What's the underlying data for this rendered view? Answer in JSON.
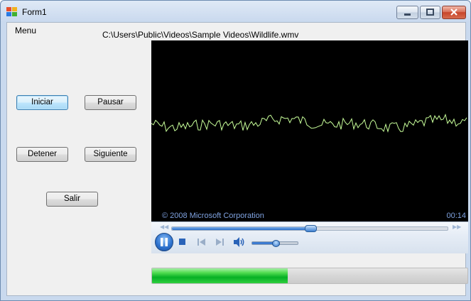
{
  "window": {
    "title": "Form1",
    "app_icon": "windows-forms-icon"
  },
  "caption_buttons": {
    "minimize_icon": "minimize-icon",
    "maximize_icon": "maximize-icon",
    "close_icon": "close-icon"
  },
  "menu": {
    "label": "Menu"
  },
  "file_path": "C:\\Users\\Public\\Videos\\Sample Videos\\Wildlife.wmv",
  "buttons": {
    "start": "Iniciar",
    "pause": "Pausar",
    "stop": "Detener",
    "next": "Siguiente",
    "exit": "Salir"
  },
  "player": {
    "copyright": "© 2008 Microsoft Corporation",
    "time": "00:14",
    "seek_fraction": 0.5,
    "volume_fraction": 0.5,
    "visualization_color": "#c8ff9a",
    "icons": [
      "pause-icon",
      "stop-icon",
      "previous-icon",
      "next-icon",
      "volume-icon",
      "rewind-icon",
      "fast-forward-icon"
    ]
  },
  "progress": {
    "fraction": 0.43
  },
  "colors": {
    "accent": "#2f74d0",
    "progress": "#06b025"
  }
}
